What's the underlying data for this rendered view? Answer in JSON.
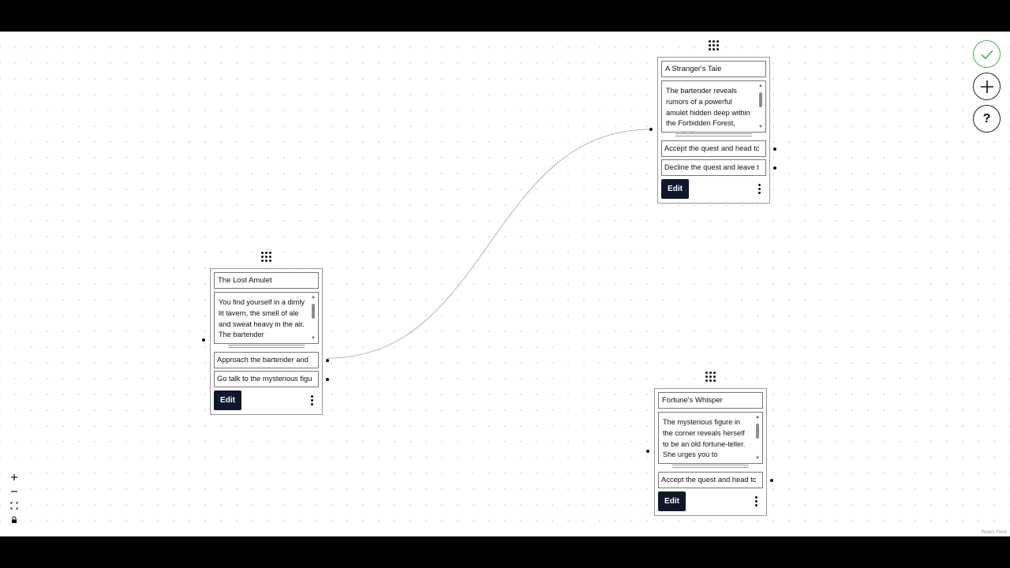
{
  "nodes": [
    {
      "title": "The Lost Amulet",
      "story": "You find yourself in a dimly lit tavern, the smell of ale and sweat heavy in the air. The bartender",
      "choices": [
        "Approach the bartender and",
        "Go talk to the mysterious figu"
      ],
      "edit_label": "Edit"
    },
    {
      "title": "A Stranger's Tale",
      "story": "The bartender reveals rumors of a powerful amulet hidden deep within the Forbidden Forest, guarded",
      "choices": [
        "Accept the quest and head tc",
        "Decline the quest and leave t"
      ],
      "edit_label": "Edit"
    },
    {
      "title": "Fortune's Whisper",
      "story": "The mysterious figure in the corner reveals herself to be an old fortune-teller. She urges you to",
      "choices": [
        "Accept the quest and head tc"
      ],
      "edit_label": "Edit"
    }
  ],
  "toolbar": {
    "save_icon": "check-icon",
    "add_icon": "plus-icon",
    "help_label": "?"
  },
  "controls": {
    "zoom_in_icon": "plus-icon",
    "zoom_out_icon": "minus-icon",
    "fit_view_icon": "fit-view-icon",
    "lock_icon": "lock-icon"
  },
  "attribution": "React Flow",
  "colors": {
    "edit_button_bg": "#0f172a",
    "save_button_accent": "#4caf50",
    "canvas_bg": "#ffffff"
  }
}
